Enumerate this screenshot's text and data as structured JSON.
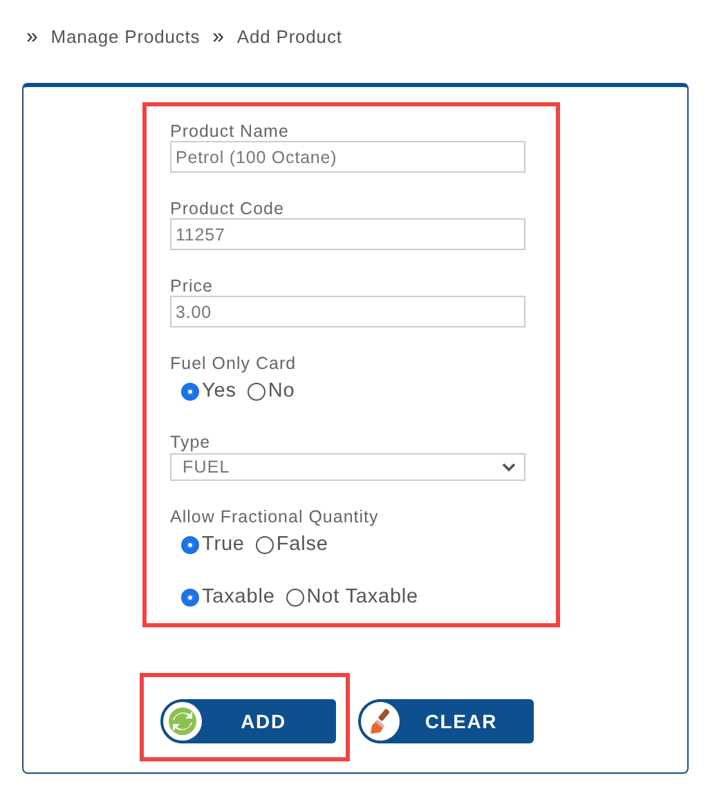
{
  "breadcrumb": [
    {
      "sep": "»",
      "label": "Manage Products"
    },
    {
      "sep": "»",
      "label": "Add Product"
    }
  ],
  "form": {
    "highlighted": true,
    "fields": [
      {
        "kind": "text",
        "label": "Product Name",
        "value": "Petrol (100 Octane)"
      },
      {
        "kind": "text",
        "label": "Product Code",
        "value": "11257"
      },
      {
        "kind": "text",
        "label": "Price",
        "value": "3.00"
      },
      {
        "kind": "radio",
        "label": "Fuel Only Card",
        "options": [
          {
            "label": "Yes",
            "selected": true
          },
          {
            "label": "No",
            "selected": false
          }
        ]
      },
      {
        "kind": "select",
        "label": "Type",
        "value": "FUEL"
      },
      {
        "kind": "radio",
        "label": "Allow Fractional Quantity",
        "options": [
          {
            "label": "True",
            "selected": true
          },
          {
            "label": "False",
            "selected": false
          }
        ]
      },
      {
        "kind": "radio",
        "options": [
          {
            "label": "Taxable",
            "selected": true
          },
          {
            "label": "Not Taxable",
            "selected": false
          }
        ]
      }
    ]
  },
  "buttons": [
    {
      "kind": "add",
      "label": "ADD",
      "highlighted": true
    },
    {
      "kind": "clear",
      "label": "CLEAR",
      "highlighted": false
    }
  ]
}
